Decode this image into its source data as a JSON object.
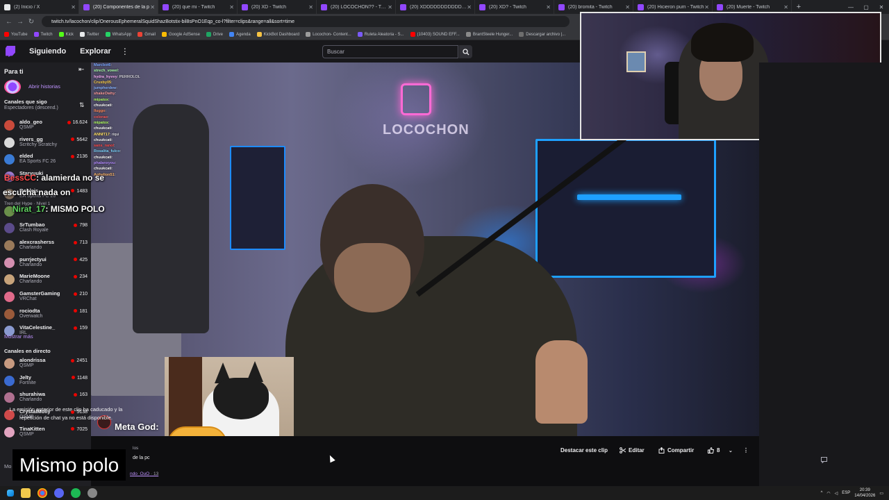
{
  "browser": {
    "tabs": [
      {
        "label": "(2) Inicio / X",
        "active": false,
        "icon": "x-icon"
      },
      {
        "label": "(20) Componentes de la p",
        "active": true,
        "icon": "twitch-icon"
      },
      {
        "label": "(20) que mi - Twitch",
        "active": false,
        "icon": "twitch-icon"
      },
      {
        "label": "(20) XD - Twitch",
        "active": false,
        "icon": "twitch-icon"
      },
      {
        "label": "(20) LOCOCHON?? - Twitch",
        "active": false,
        "icon": "twitch-icon"
      },
      {
        "label": "(20) XDDDDDDDDDDDDD",
        "active": false,
        "icon": "twitch-icon"
      },
      {
        "label": "(20) XD? - Twitch",
        "active": false,
        "icon": "twitch-icon"
      },
      {
        "label": "(20) bromita - Twitch",
        "active": false,
        "icon": "twitch-icon"
      },
      {
        "label": "(20) Hicieron pum - Twitch",
        "active": false,
        "icon": "twitch-icon"
      },
      {
        "label": "(20) Muerte - Twitch",
        "active": false,
        "icon": "twitch-icon"
      }
    ],
    "new_tab": "+",
    "url": "twitch.tv/lacochon/clip/OnerousEphemeralSquidShazBotstix-bil8sPnO1Eqp_co-l?filter=clips&range=all&sort=time",
    "bookmarks": [
      {
        "label": "YouTube",
        "color": "#ff0000"
      },
      {
        "label": "Twitch",
        "color": "#9147ff"
      },
      {
        "label": "Kick",
        "color": "#53fc18"
      },
      {
        "label": "Twitter",
        "color": "#e7e9ea"
      },
      {
        "label": "WhatsApp",
        "color": "#25d366"
      },
      {
        "label": "Gmail",
        "color": "#ea4335"
      },
      {
        "label": "Google AdSense",
        "color": "#fbbc04"
      },
      {
        "label": "Drive",
        "color": "#1fa463"
      },
      {
        "label": "Agenda",
        "color": "#4285f4"
      },
      {
        "label": "KickBot Dashboard",
        "color": "#f6c343"
      },
      {
        "label": "Locochon- Content...",
        "color": "#9c9c9c"
      },
      {
        "label": "Ruleta Aleatoria - S...",
        "color": "#7a5af8"
      },
      {
        "label": "(10403) SOUND EFF...",
        "color": "#ff0000"
      },
      {
        "label": "BrantSteele Hunger...",
        "color": "#8a8a8a"
      },
      {
        "label": "Descargar archivo |...",
        "color": "#6e6e6e"
      }
    ]
  },
  "nav": {
    "following": "Siguiendo",
    "explore": "Explorar",
    "search_placeholder": "Buscar"
  },
  "sidebar": {
    "for_you": "Para ti",
    "open_stories": "Abrir historias",
    "followed_header": "Canales que sigo",
    "sort_label": "Espectadores (descend.)",
    "followed": [
      {
        "name": "aldo_geo",
        "game": "QSMP",
        "viewers": "16.624",
        "color": "#c94a3b"
      },
      {
        "name": "rivers_gg",
        "game": "Scritchy Scratchy",
        "viewers": "5642",
        "color": "#d9d9d9"
      },
      {
        "name": "elded",
        "game": "EA Sports FC 26",
        "viewers": "2136",
        "color": "#3a7bd5"
      },
      {
        "name": "Staryuuki",
        "game": "",
        "viewers": "",
        "color": "#9e7bd0"
      },
      {
        "name": "Robleis",
        "game": "EA Sports FC 26",
        "viewers": "1483",
        "color": "#7c6a5a"
      },
      {
        "name": "",
        "game": "",
        "viewers": "",
        "color": "#6a8f4a"
      },
      {
        "name": "SrTumbao",
        "game": "Clash Royale",
        "viewers": "798",
        "color": "#5b4b8a"
      },
      {
        "name": "alexcrasherss",
        "game": "Charlando",
        "viewers": "713",
        "color": "#9a7a5a"
      },
      {
        "name": "purrjectyui",
        "game": "Charlando",
        "viewers": "425",
        "color": "#d48fb0"
      },
      {
        "name": "MarieMoone",
        "game": "Charlando",
        "viewers": "234",
        "color": "#c7a37a"
      },
      {
        "name": "GamsterGaming",
        "game": "VRChat",
        "viewers": "210",
        "color": "#e06a8a"
      },
      {
        "name": "rociodta",
        "game": "Overwatch",
        "viewers": "181",
        "color": "#9a5a3a"
      },
      {
        "name": "VitaCelestine_",
        "game": "IRL",
        "viewers": "159",
        "color": "#8a9ad0"
      }
    ],
    "show_more": "Mostrar más",
    "live_header": "Canales en directo",
    "live": [
      {
        "name": "alondrissa",
        "game": "QSMP",
        "viewers": "2451",
        "color": "#c79a80"
      },
      {
        "name": "Jelty",
        "game": "Fortnite",
        "viewers": "1148",
        "color": "#3a6ad0"
      },
      {
        "name": "shurahiwa",
        "game": "Charlando",
        "viewers": "163",
        "color": "#b07090"
      },
      {
        "name": "CrystalMolly",
        "game": "QSMP",
        "viewers": "5138",
        "color": "#d04a4a"
      },
      {
        "name": "TinaKitten",
        "game": "QSMP",
        "viewers": "7025",
        "color": "#e2a4c0"
      }
    ],
    "show_more_bottom": "Mo"
  },
  "video": {
    "neon_text": "LOCOCHON",
    "chat_lines": [
      {
        "user": "Marcbot6",
        "msg": "",
        "color": "#7aa7ff"
      },
      {
        "user": "strech_vowel",
        "msg": "",
        "color": "#aaffaa"
      },
      {
        "user": "hydra_hyvvy",
        "msg": "PERROLOL",
        "color": "#ffb3ff"
      },
      {
        "user": "Cruxby05",
        "msg": "",
        "color": "#ffd24d"
      },
      {
        "user": "jumpherdew",
        "msg": "",
        "color": "#8ab4ff"
      },
      {
        "user": "shakeOwhy",
        "msg": "",
        "color": "#ff9e9e"
      },
      {
        "user": "mipatox",
        "msg": "",
        "color": "#b3ff66"
      },
      {
        "user": "chuukcati",
        "msg": "",
        "color": "#ffffff"
      },
      {
        "user": "lluggo",
        "msg": "",
        "color": "#ff8a5c"
      },
      {
        "user": "colorao",
        "msg": "",
        "color": "#ff5c5c"
      },
      {
        "user": "mipatox",
        "msg": "",
        "color": "#b3ff66"
      },
      {
        "user": "chuukcati",
        "msg": "",
        "color": "#ffffff"
      },
      {
        "user": "ANNIT17",
        "msg": "riqui",
        "color": "#ffe066"
      },
      {
        "user": "chuukcati",
        "msg": "",
        "color": "#ffffff"
      },
      {
        "user": "sans_ranol",
        "msg": "",
        "color": "#ff4d4d"
      },
      {
        "user": "Rosalita_fulco",
        "msg": "",
        "color": "#7dd3fc"
      },
      {
        "user": "chuukcati",
        "msg": "",
        "color": "#ffffff"
      },
      {
        "user": "phalanxyou",
        "msg": "",
        "color": "#b48cff"
      },
      {
        "user": "chuukcati",
        "msg": "",
        "color": "#ffffff"
      },
      {
        "user": "Aphelion51",
        "msg": "",
        "color": "#ffb86b"
      }
    ],
    "big_chat_1_user": "BessCC",
    "big_chat_1_msg": ": alamierda no se",
    "big_chat_1_cont": "escucha nada on",
    "big_chat_2_user": "Nirat_17",
    "big_chat_2_msg": ": MISMO POLO",
    "meta_god": "Meta God:",
    "subtitle": "Mismo polo"
  },
  "clip_info": {
    "meta1": "los",
    "meta2": "de la pc",
    "meta3_link": "ndo_OuO",
    "meta3_rest": " · 13",
    "feature_clip": "Destacar este clip",
    "edit": "Editar",
    "share": "Compartir",
    "likes": "8"
  },
  "sidebar_overlay": {
    "tren": "Tren del Hype · Nivel 1"
  },
  "chat": {
    "expired_msg": "La emisión anterior de este clip ha caducado y la repetición de chat ya no está disponible."
  },
  "taskbar": {
    "lang": "ESP",
    "time": "20:39",
    "date": "14/04/2026"
  },
  "colors": {
    "twitch_purple": "#9147ff",
    "live_red": "#eb0400",
    "link_purple": "#bf94ff"
  }
}
